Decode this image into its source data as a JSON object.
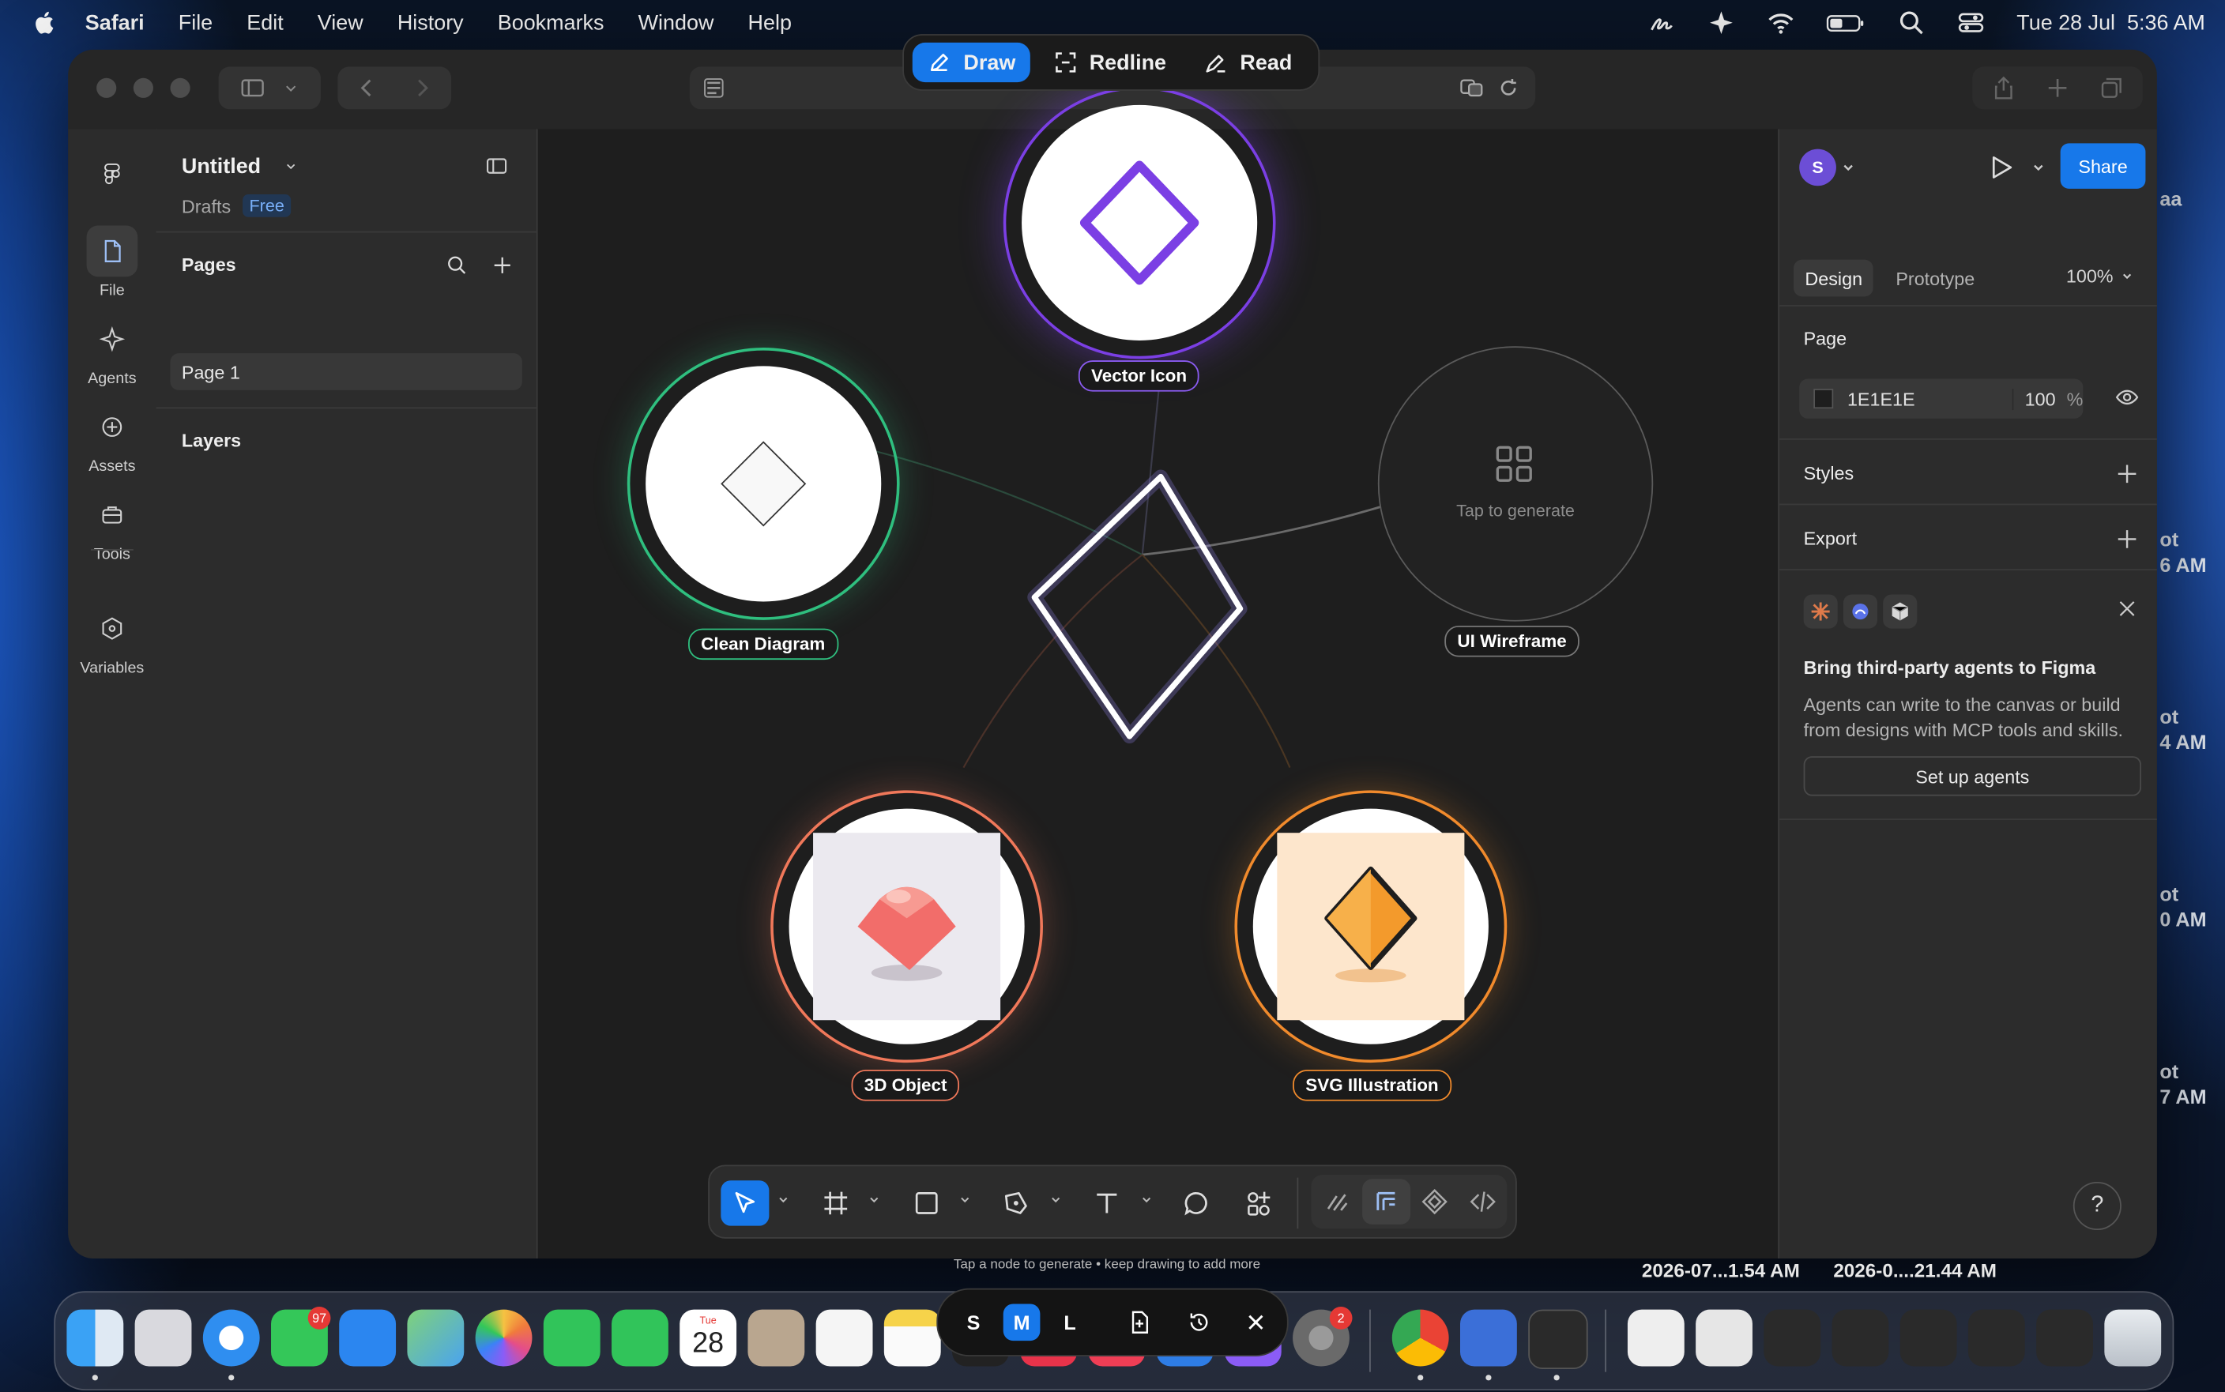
{
  "menubar": {
    "app_name": "Safari",
    "items": [
      "File",
      "Edit",
      "View",
      "History",
      "Bookmarks",
      "Window",
      "Help"
    ],
    "clock": "Tue 28 Jul  5:36 AM"
  },
  "modes": [
    {
      "label": "Draw",
      "active": true
    },
    {
      "label": "Redline",
      "active": false
    },
    {
      "label": "Read",
      "active": false
    }
  ],
  "rail": [
    {
      "label": "File",
      "icon": "file-icon",
      "active": true
    },
    {
      "label": "Agents",
      "icon": "agents-icon",
      "active": false
    },
    {
      "label": "Assets",
      "icon": "assets-icon",
      "active": false
    },
    {
      "label": "Tools",
      "icon": "tools-icon",
      "active": false
    },
    {
      "label": "Variables",
      "icon": "variables-icon",
      "active": false
    }
  ],
  "left_panel": {
    "file_title": "Untitled",
    "location": "Drafts",
    "plan_badge": "Free",
    "pages_heading": "Pages",
    "pages": [
      "Page 1"
    ],
    "layers_heading": "Layers"
  },
  "canvas": {
    "nodes": [
      {
        "label": "Vector Icon",
        "color": "#7b3fe4"
      },
      {
        "label": "Clean Diagram",
        "color": "#2fbf7f"
      },
      {
        "label": "UI Wireframe",
        "color": "#6a6a6a"
      },
      {
        "label": "3D Object",
        "color": "#f0785a"
      },
      {
        "label": "SVG Illustration",
        "color": "#f08a2c"
      }
    ],
    "placeholder_text": "Tap to generate",
    "hint": "Tap a node to generate • keep drawing to add more"
  },
  "right_panel": {
    "avatar_initial": "S",
    "share_label": "Share",
    "tabs": [
      "Design",
      "Prototype"
    ],
    "zoom": "100%",
    "page_heading": "Page",
    "page_fill_hex": "1E1E1E",
    "page_fill_opacity": "100",
    "percent_sign": "%",
    "styles_heading": "Styles",
    "export_heading": "Export",
    "promo_title": "Bring third-party agents to Figma",
    "promo_body": "Agents can write to the canvas or build from designs with MCP tools and skills.",
    "promo_button": "Set up agents",
    "help": "?"
  },
  "size_switch": [
    "S",
    "M",
    "L"
  ],
  "desktop": {
    "screenshot_labels": [
      "2026-07...1.54 AM",
      "2026-0....21.44 AM"
    ],
    "side_labels": [
      "aa",
      "ot",
      "6 AM",
      "ot",
      "4 AM",
      "ot",
      "0 AM",
      "ot",
      "7 AM"
    ],
    "calendar_day": "28",
    "calendar_month": "Tue",
    "messages_badge": "97",
    "settings_badge": "2"
  }
}
